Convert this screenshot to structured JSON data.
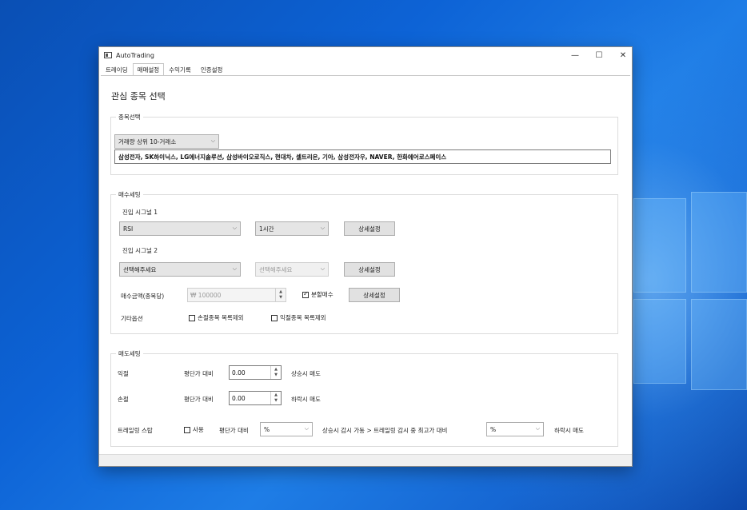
{
  "window": {
    "title": "AutoTrading"
  },
  "tabs": [
    {
      "label": "트레이딩"
    },
    {
      "label": "매매설정"
    },
    {
      "label": "수익기록"
    },
    {
      "label": "인증설정"
    }
  ],
  "page_title": "관심 종목 선택",
  "stock_group": {
    "legend": "종목선택",
    "selector_value": "거래량 상위 10-거래소",
    "stock_list": "삼성전자, SK하이닉스, LG에너지솔루션, 삼성바이오로직스, 현대차, 셀트리온, 기아, 삼성전자우, NAVER, 한화에어로스페이스"
  },
  "buy_group": {
    "legend": "매수세팅",
    "signal1_label": "진입 시그널 1",
    "signal1_value": "RSI",
    "signal1_timeframe": "1시간",
    "signal1_detail": "상세설정",
    "signal2_label": "진입 시그널 2",
    "signal2_value": "선택해주세요",
    "signal2_timeframe": "선택해주세요",
    "signal2_detail": "상세설정",
    "amount_label": "매수금액(종목당)",
    "amount_value": "₩ 100000",
    "split_buy_label": "분할매수",
    "split_buy_checked": true,
    "split_detail": "상세설정",
    "other_label": "기타옵션",
    "exclude_loss_label": "손절종목 목록제외",
    "exclude_profit_label": "익절종목 목록제외"
  },
  "sell_group": {
    "legend": "매도세팅",
    "profit_label": "익절",
    "profit_compare": "평단가 대비",
    "profit_value": "0.00",
    "profit_suffix": "상승시 매도",
    "loss_label": "손절",
    "loss_compare": "평단가 대비",
    "loss_value": "0.00",
    "loss_suffix": "하락시 매도",
    "trailing_label": "트레일링 스탑",
    "trailing_use": "사용",
    "trailing_compare": "평단가 대비",
    "trailing_value1": "%",
    "trailing_mid": "상승시 감시 가동  >  트레일링 감시 중 최고가 대비",
    "trailing_value2": "%",
    "trailing_suffix": "하락시 매도"
  },
  "colors": {
    "desktop": "#0d63d6",
    "window_bg": "#ffffff",
    "button_bg": "#e1e1e1"
  }
}
